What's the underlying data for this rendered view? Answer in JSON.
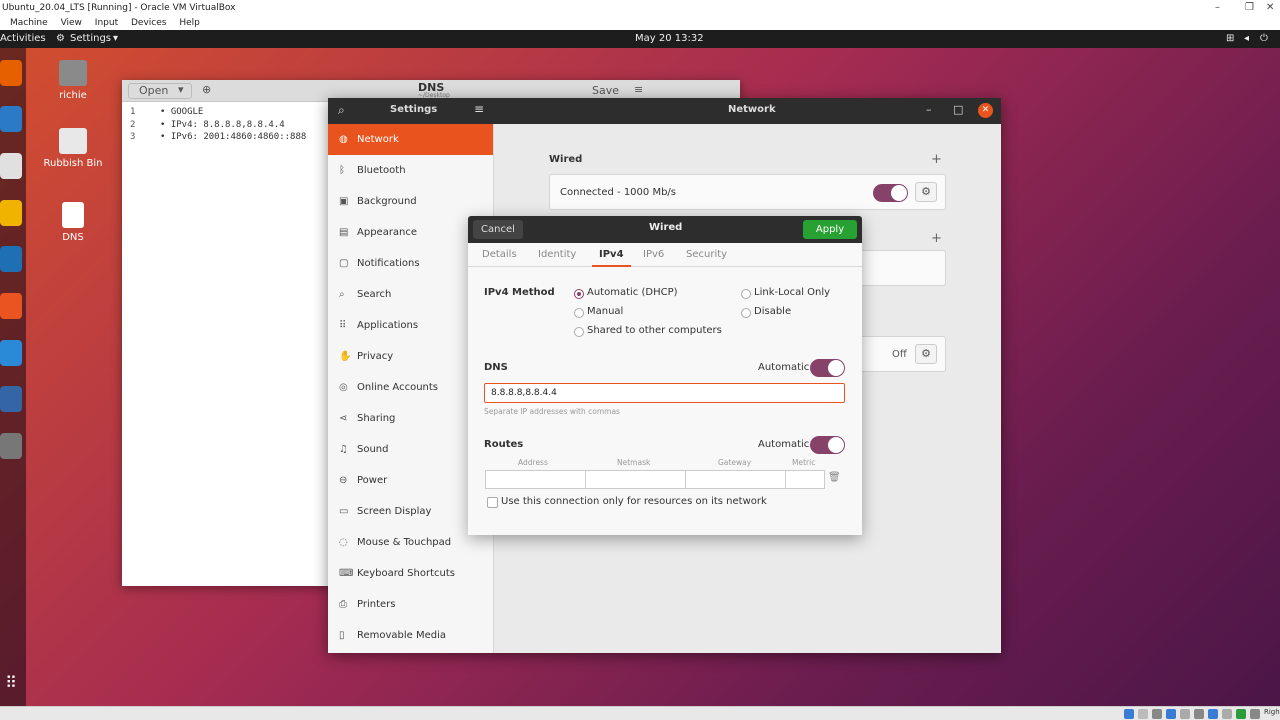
{
  "vbox": {
    "title": "Ubuntu_20.04_LTS [Running] - Oracle VM VirtualBox",
    "menu": [
      "Machine",
      "View",
      "Input",
      "Devices",
      "Help"
    ],
    "controls": [
      "–",
      "❐",
      "✕"
    ],
    "right_ctrl": "Right Ctrl"
  },
  "topbar": {
    "activities": "Activities",
    "app_menu": "Settings",
    "clock": "May 20  13:32"
  },
  "desktop_icons": [
    {
      "label": "richie"
    },
    {
      "label": "Rubbish Bin"
    },
    {
      "label": "DNS"
    }
  ],
  "gedit": {
    "open_label": "Open",
    "title": "DNS",
    "subtitle": "~/Desktop",
    "save_label": "Save",
    "lines": [
      {
        "n": "1",
        "text": "• GOOGLE"
      },
      {
        "n": "2",
        "text": "• IPv4: 8.8.8.8,8.8.4.4"
      },
      {
        "n": "3",
        "text": "• IPv6: 2001:4860:4860::888"
      }
    ]
  },
  "settings": {
    "title": "Settings",
    "panel_title": "Network",
    "sidebar": [
      {
        "label": "Network",
        "icon": "network-icon",
        "glyph": "◍"
      },
      {
        "label": "Bluetooth",
        "icon": "bluetooth-icon",
        "glyph": "ᛒ"
      },
      {
        "label": "Background",
        "icon": "background-icon",
        "glyph": "▣"
      },
      {
        "label": "Appearance",
        "icon": "appearance-icon",
        "glyph": "▤"
      },
      {
        "label": "Notifications",
        "icon": "notifications-icon",
        "glyph": "▢"
      },
      {
        "label": "Search",
        "icon": "search-icon",
        "glyph": "⌕"
      },
      {
        "label": "Applications",
        "icon": "applications-icon",
        "glyph": "⠿"
      },
      {
        "label": "Privacy",
        "icon": "privacy-icon",
        "glyph": "✋"
      },
      {
        "label": "Online Accounts",
        "icon": "online-accounts-icon",
        "glyph": "◎"
      },
      {
        "label": "Sharing",
        "icon": "sharing-icon",
        "glyph": "⋖"
      },
      {
        "label": "Sound",
        "icon": "sound-icon",
        "glyph": "♫"
      },
      {
        "label": "Power",
        "icon": "power-icon",
        "glyph": "⊖"
      },
      {
        "label": "Screen Display",
        "icon": "display-icon",
        "glyph": "▭"
      },
      {
        "label": "Mouse & Touchpad",
        "icon": "mouse-icon",
        "glyph": "◌"
      },
      {
        "label": "Keyboard Shortcuts",
        "icon": "keyboard-icon",
        "glyph": "⌨"
      },
      {
        "label": "Printers",
        "icon": "printer-icon",
        "glyph": "⎙"
      },
      {
        "label": "Removable Media",
        "icon": "removable-media-icon",
        "glyph": "▯"
      }
    ],
    "wired_heading": "Wired",
    "wired_status": "Connected - 1000 Mb/s",
    "wired_enabled": true,
    "add": "+",
    "gear": "⚙",
    "proxy_status": "Off"
  },
  "dialog": {
    "title": "Wired",
    "cancel": "Cancel",
    "apply": "Apply",
    "tabs": [
      "Details",
      "Identity",
      "IPv4",
      "IPv6",
      "Security"
    ],
    "active_tab": "IPv4",
    "method_label": "IPv4 Method",
    "methods": [
      "Automatic (DHCP)",
      "Manual",
      "Shared to other computers",
      "Link-Local Only",
      "Disable"
    ],
    "selected_method": "Automatic (DHCP)",
    "dns_label": "DNS",
    "automatic": "Automatic",
    "dns_automatic_on": true,
    "dns_value": "8.8.8.8,8.8.4.4",
    "dns_hint": "Separate IP addresses with commas",
    "routes_label": "Routes",
    "routes_automatic_on": true,
    "route_cols": [
      "Address",
      "Netmask",
      "Gateway",
      "Metric"
    ],
    "resources_only": "Use this connection only for resources on its network",
    "resources_only_checked": false
  },
  "colors": {
    "accent": "#e9541e",
    "toggle": "#87426a",
    "apply_green": "#26a132"
  }
}
